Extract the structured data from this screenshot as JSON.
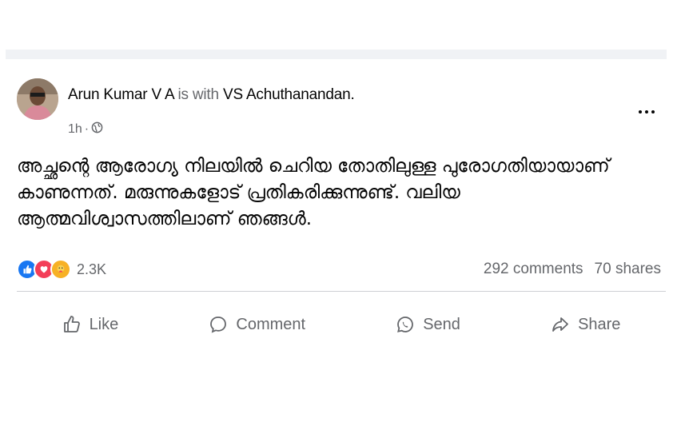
{
  "post": {
    "author_name": "Arun Kumar V A",
    "is_with_text": "is with",
    "tagged_name": "VS Achuthanandan.",
    "time": "1h",
    "audience_icon": "globe-icon",
    "text_lines": [
      "അച്ഛന്റെ ആരോഗ്യ നിലയിൽ ചെറിയ തോതിലുള്ള പുരോഗതിയായാണ്",
      "കാണുന്നത്. മരുന്നുകളോട് പ്രതികരിക്കുന്നുണ്ട്.  വലിയ",
      "ആത്മവിശ്വാസത്തിലാണ് ഞങ്ങൾ."
    ]
  },
  "reactions": {
    "icons": [
      "like-icon",
      "love-icon",
      "care-icon"
    ],
    "count": "2.3K",
    "comments": "292 comments",
    "shares": "70 shares"
  },
  "actions": {
    "like": "Like",
    "comment": "Comment",
    "send": "Send",
    "share": "Share"
  },
  "colors": {
    "like_blue": "#1877f2",
    "love_red": "#f33e58",
    "care_yellow": "#f7b125",
    "secondary_text": "#65676b",
    "divider": "#ced0d4"
  }
}
